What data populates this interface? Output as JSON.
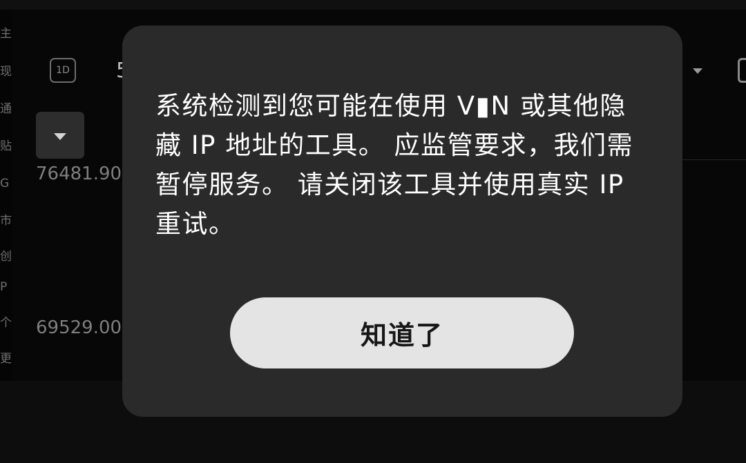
{
  "background": {
    "timeframe_label": "1D",
    "partial_label": "5",
    "rail_chars": [
      "主",
      "现",
      "通",
      "贴",
      "G",
      "市",
      "创",
      "P",
      "个",
      "更"
    ],
    "prices": [
      "76481.900",
      "69529.00"
    ]
  },
  "dialog": {
    "message": "系统检测到您可能在使用 V▮N 或其他隐藏 IP 地址的工具。 应监管要求，我们需暂停服务。 请关闭该工具并使用真实 IP 重试。",
    "button_label": "知道了"
  },
  "colors": {
    "page_background": "#0d0d0d",
    "dialog_background": "#2a2a2a",
    "dialog_text": "#ffffff",
    "button_background": "#e4e4e4",
    "button_text": "#161616"
  }
}
